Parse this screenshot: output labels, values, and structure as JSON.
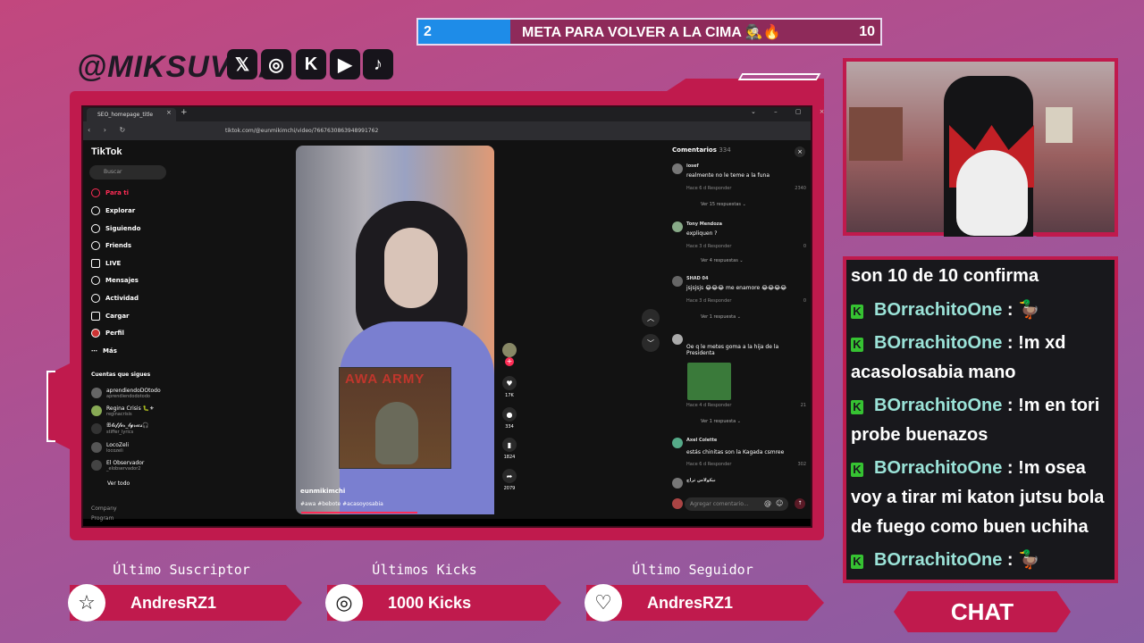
{
  "goal": {
    "current": "2",
    "label": "META PARA VOLVER A LA CIMA 🕵🔥",
    "target": "10",
    "progress": 0.2
  },
  "header": {
    "handle": "@MIKSUVT /",
    "socials": [
      "X",
      "instagram-icon",
      "kick-icon",
      "youtube-icon",
      "tiktok-icon"
    ]
  },
  "browser": {
    "tab_title": "SEO_homepage_title",
    "url": "tiktok.com/@eunmikimchi/video/7667630863948991762"
  },
  "tiktok": {
    "logo": "TikTok",
    "search_placeholder": "Buscar",
    "nav": [
      "Para ti",
      "Explorar",
      "Siguiendo",
      "Friends",
      "LIVE",
      "Mensajes",
      "Actividad",
      "Cargar",
      "Perfil",
      "Más"
    ],
    "following_header": "Cuentas que sigues",
    "following": [
      {
        "name": "aprendiendoDOtodo",
        "handle": "aprendiendodotodo"
      },
      {
        "name": "Regina Crisis 🐛⚜",
        "handle": "reginacrisis"
      },
      {
        "name": "ꕥ𝓽𝓲𝓯𝓯𝓮𝓻_𝓵𝔂𝓻𝓲𝓬𝓼🎧",
        "handle": "stiffer_lyrics"
      },
      {
        "name": "LocoZeli",
        "handle": "locozeli"
      },
      {
        "name": "El Observador",
        "handle": "_elobservador2"
      }
    ],
    "see_all": "Ver todo",
    "footer": [
      "Company",
      "Program"
    ],
    "video": {
      "author": "eunmikimchi",
      "tags": "#awa #bebote #acasoyosabia",
      "sticker_text": "AWA ARMY",
      "likes": "17K",
      "comments": "334",
      "saves": "1824",
      "shares": "2079"
    },
    "comments_title": "Comentarios",
    "comments_count": "334",
    "comments": [
      {
        "user": "iosef",
        "text": "realmente no le teme a la funa",
        "meta": "Hace 6 d   Responder",
        "likes": "2340",
        "replies": "Ver 15 respuestas ⌄"
      },
      {
        "user": "Tony Mendoza",
        "text": "expliquen ?",
        "meta": "Hace 3 d   Responder",
        "likes": "0",
        "replies": "Ver 4 respuestas ⌄"
      },
      {
        "user": "SHAD 04",
        "text": "jsjsjsjs 😂😂😂 me enamore 😂😂😂😂",
        "meta": "Hace 3 d   Responder",
        "likes": "0",
        "replies": "Ver 1 respuesta ⌄"
      },
      {
        "user": "",
        "text": "Oe q le metes goma a la hija de la Presidenta",
        "meta": "Hace 4 d   Responder",
        "likes": "21",
        "replies": "Ver 1 respuesta ⌄"
      },
      {
        "user": "Axel Colette",
        "text": "estás chinitas son la Kagada csmree",
        "meta": "Hace 6 d   Responder",
        "likes": "302",
        "replies": ""
      },
      {
        "user": "نيكولاس ثراج",
        "text": "",
        "meta": "",
        "likes": "",
        "replies": ""
      }
    ],
    "comment_placeholder": "Agregar comentario..."
  },
  "chat": {
    "lines": [
      {
        "user": "",
        "text": "son 10 de 10 confirma"
      },
      {
        "user": "BOrrachitoOne",
        "text": ": 🦆"
      },
      {
        "user": "BOrrachitoOne",
        "text": ": !m xd acasolosabia mano"
      },
      {
        "user": "BOrrachitoOne",
        "text": ": !m en tori probe buenazos"
      },
      {
        "user": "BOrrachitoOne",
        "text": ": !m osea voy a tirar mi katon jutsu bola de fuego como buen uchiha"
      },
      {
        "user": "BOrrachitoOne",
        "text": ": 🦆"
      }
    ],
    "button": "CHAT"
  },
  "widgets": [
    {
      "title": "Último Suscriptor",
      "value": "AndresRZ1",
      "icon": "star-icon"
    },
    {
      "title": "Últimos Kicks",
      "value": "1000 Kicks",
      "icon": "kick-coin-icon"
    },
    {
      "title": "Último Seguidor",
      "value": "AndresRZ1",
      "icon": "heart-icon"
    }
  ],
  "colors": {
    "accent": "#c01a4d",
    "goal_fill": "#1e8ce8",
    "kick_green": "#36c232",
    "chat_name": "#9be3d8"
  }
}
